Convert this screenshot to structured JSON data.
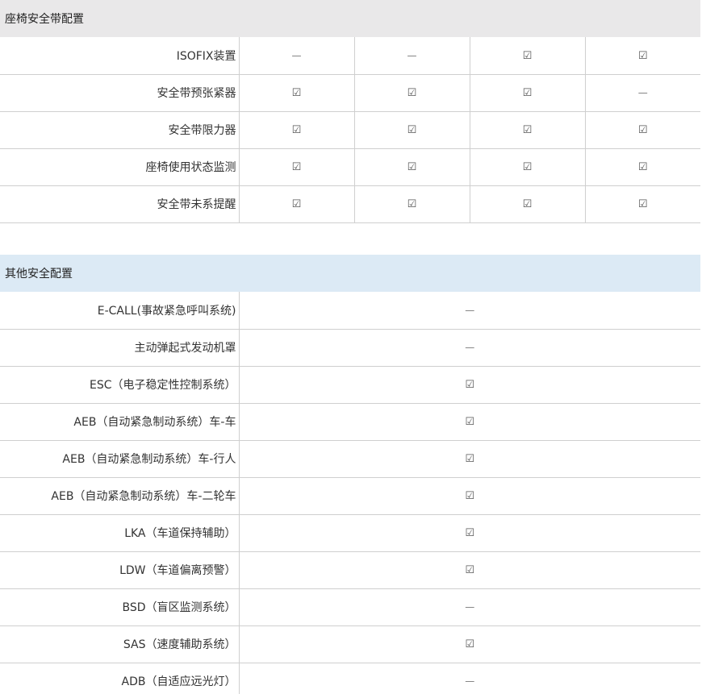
{
  "seat_section": {
    "title": "座椅安全带配置",
    "rows": [
      {
        "label": "ISOFIX装置",
        "values": [
          "—",
          "—",
          "☑",
          "☑"
        ],
        "icons": [
          "dash-icon",
          "dash-icon",
          "checkbox-checked-icon",
          "checkbox-checked-icon"
        ]
      },
      {
        "label": "安全带预张紧器",
        "values": [
          "☑",
          "☑",
          "☑",
          "—"
        ],
        "icons": [
          "checkbox-checked-icon",
          "checkbox-checked-icon",
          "checkbox-checked-icon",
          "dash-icon"
        ]
      },
      {
        "label": "安全带限力器",
        "values": [
          "☑",
          "☑",
          "☑",
          "☑"
        ],
        "icons": [
          "checkbox-checked-icon",
          "checkbox-checked-icon",
          "checkbox-checked-icon",
          "checkbox-checked-icon"
        ]
      },
      {
        "label": "座椅使用状态监测",
        "values": [
          "☑",
          "☑",
          "☑",
          "☑"
        ],
        "icons": [
          "checkbox-checked-icon",
          "checkbox-checked-icon",
          "checkbox-checked-icon",
          "checkbox-checked-icon"
        ]
      },
      {
        "label": "安全带未系提醒",
        "values": [
          "☑",
          "☑",
          "☑",
          "☑"
        ],
        "icons": [
          "checkbox-checked-icon",
          "checkbox-checked-icon",
          "checkbox-checked-icon",
          "checkbox-checked-icon"
        ]
      }
    ]
  },
  "other_section": {
    "title": "其他安全配置",
    "rows": [
      {
        "label": "E-CALL(事故紧急呼叫系统)",
        "value": "—",
        "icon": "dash-icon"
      },
      {
        "label": "主动弹起式发动机罩",
        "value": "—",
        "icon": "dash-icon"
      },
      {
        "label": "ESC（电子稳定性控制系统）",
        "value": "☑",
        "icon": "checkbox-checked-icon"
      },
      {
        "label": "AEB（自动紧急制动系统）车-车",
        "value": "☑",
        "icon": "checkbox-checked-icon"
      },
      {
        "label": "AEB（自动紧急制动系统）车-行人",
        "value": "☑",
        "icon": "checkbox-checked-icon"
      },
      {
        "label": "AEB（自动紧急制动系统）车-二轮车",
        "value": "☑",
        "icon": "checkbox-checked-icon"
      },
      {
        "label": "LKA（车道保持辅助）",
        "value": "☑",
        "icon": "checkbox-checked-icon"
      },
      {
        "label": "LDW（车道偏离预警）",
        "value": "☑",
        "icon": "checkbox-checked-icon"
      },
      {
        "label": "BSD（盲区监测系统）",
        "value": "—",
        "icon": "dash-icon"
      },
      {
        "label": "SAS（速度辅助系统）",
        "value": "☑",
        "icon": "checkbox-checked-icon"
      },
      {
        "label": "ADB（自适应远光灯）",
        "value": "—",
        "icon": "dash-icon"
      }
    ]
  },
  "colors": {
    "seat_header_bg": "#e9e8e9",
    "other_header_bg": "#dceaf5",
    "grid_line": "#cfcfcf",
    "text": "#333333"
  }
}
